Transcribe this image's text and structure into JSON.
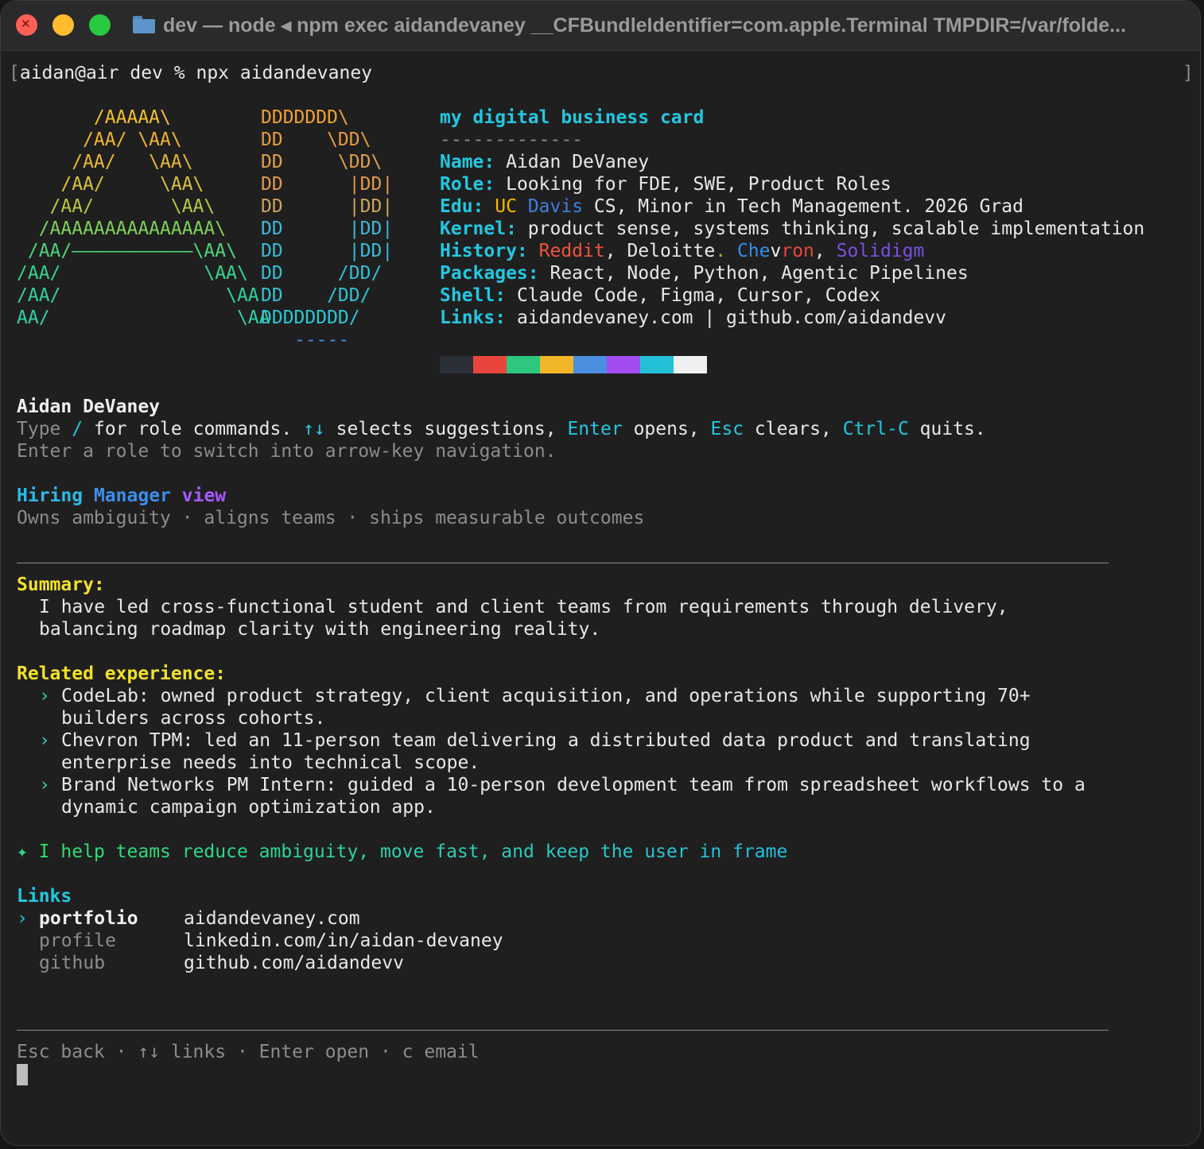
{
  "window": {
    "title": "dev — node ◂ npm exec aidandevaney __CFBundleIdentifier=com.apple.Terminal TMPDIR=/var/folde..."
  },
  "prompt": {
    "user_host": "aidan@air",
    "dir": "dev",
    "symbol": "%",
    "command": "npx aidandevaney",
    "open_bracket": "[",
    "close_bracket": "]"
  },
  "ascii_art": {
    "a_lines": [
      "       /AAAAA\\",
      "      /AA/ \\AA\\",
      "     /AA/   \\AA\\",
      "    /AA/     \\AA\\",
      "   /AA/       \\AA\\",
      "  /AAAAAAAAAAAAAAA\\",
      " /AA/———————————\\AA\\",
      "/AA/             \\AA\\",
      "/AA/               \\AA",
      "AA/                 \\AA"
    ],
    "d_lines": [
      "DDDDDDD\\",
      "DD    \\DD\\",
      "DD     \\DD\\",
      "DD      |DD|",
      "DD      |DD|",
      "DD      |DD|",
      "DD      |DD|",
      "DD     /DD/",
      "DD    /DD/",
      "DDDDDDDD/"
    ],
    "underline": "-----"
  },
  "card": {
    "heading": "my digital business card",
    "divider": "-------------",
    "name_label": "Name:",
    "name_value": "Aidan DeVaney",
    "role_label": "Role:",
    "role_value": "Looking for FDE, SWE, Product Roles",
    "edu_label": "Edu:",
    "edu_uc": "UC",
    "edu_davis": "Davis",
    "edu_rest": "CS, Minor in Tech Management. 2026 Grad",
    "kernel_label": "Kernel:",
    "kernel_value": "product sense, systems thinking, scalable implementation",
    "history_label": "History:",
    "history_reddit": "Reddit",
    "history_sep1": ", ",
    "history_deloitte": "Deloitte",
    "history_dot": ".",
    "history_chevron_a": "Che",
    "history_chevron_b": "v",
    "history_chevron_c": "ron",
    "history_sep2": ", ",
    "history_solidigm": "Solidigm",
    "packages_label": "Packages:",
    "packages_value": "React, Node, Python, Agentic Pipelines",
    "shell_label": "Shell:",
    "shell_value": "Claude Code, Figma, Cursor, Codex",
    "links_label": "Links:",
    "links_value": "aidandevaney.com | github.com/aidandevv",
    "palette": [
      "#2a2f37",
      "#2a2f37",
      "#e8463d",
      "#e8463d",
      "#2ec77f",
      "#2ec77f",
      "#f2b728",
      "#f2b728",
      "#4a8fe0",
      "#4a8fe0",
      "#a34cf0",
      "#a34cf0",
      "#23c0d8",
      "#23c0d8",
      "#f0f0f0",
      "#f0f0f0"
    ]
  },
  "intro": {
    "name": "Aidan DeVaney",
    "type_word": "Type",
    "slash": "/",
    "for_role": "for role commands.",
    "arrows": "↑↓",
    "selects": "selects suggestions,",
    "enter": "Enter",
    "opens": "opens,",
    "esc": "Esc",
    "clears": "clears,",
    "ctrlc": "Ctrl-C",
    "quits": "quits.",
    "hint": "Enter a role to switch into arrow-key navigation."
  },
  "view": {
    "word1": "Hiring",
    "word2": "Manager",
    "word3": "view",
    "tagline": "Owns ambiguity · aligns teams · ships measurable outcomes"
  },
  "summary": {
    "label": "Summary:",
    "line1": "I have led cross-functional student and client teams from requirements through delivery,",
    "line2": "balancing roadmap clarity with engineering reality."
  },
  "experience": {
    "label": "Related experience:",
    "bullet": "›",
    "items": [
      {
        "line1": "CodeLab: owned product strategy, client acquisition, and operations while supporting 70+",
        "line2": "builders across cohorts."
      },
      {
        "line1": "Chevron TPM: led an 11-person team delivering a distributed data product and translating",
        "line2": "enterprise needs into technical scope."
      },
      {
        "line1": "Brand Networks PM Intern: guided a 10-person development team from spreadsheet workflows to a",
        "line2": "dynamic campaign optimization app."
      }
    ]
  },
  "tagline": {
    "star": "✦",
    "text": "I help teams reduce ambiguity, move fast, and keep the user in frame"
  },
  "links": {
    "label": "Links",
    "selector": "›",
    "items": [
      {
        "name": "portfolio",
        "url": "aidandevaney.com"
      },
      {
        "name": "profile",
        "url": "linkedin.com/in/aidan-devaney"
      },
      {
        "name": "github",
        "url": "github.com/aidandevv"
      }
    ]
  },
  "footer": {
    "hints": "Esc back · ↑↓ links · Enter open · c email"
  }
}
